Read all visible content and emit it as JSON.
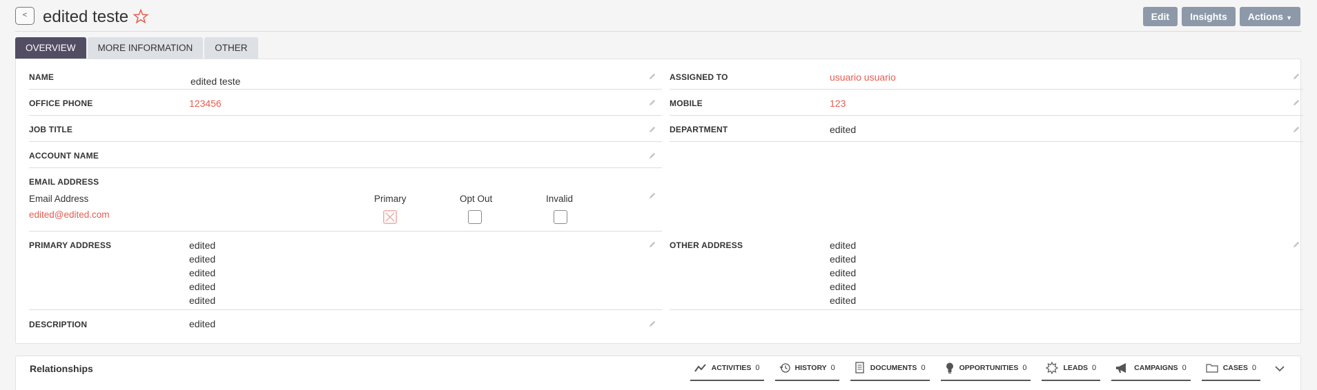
{
  "header": {
    "back_label": "<",
    "title": "edited teste",
    "buttons": {
      "edit": "Edit",
      "insights": "Insights",
      "actions": "Actions"
    }
  },
  "tabs": [
    {
      "label": "OVERVIEW"
    },
    {
      "label": "MORE INFORMATION"
    },
    {
      "label": "OTHER"
    }
  ],
  "fields": {
    "name": {
      "label": "NAME",
      "value": "edited teste"
    },
    "office_phone": {
      "label": "OFFICE PHONE",
      "value": "123456"
    },
    "job_title": {
      "label": "JOB TITLE",
      "value": ""
    },
    "account_name": {
      "label": "ACCOUNT NAME",
      "value": ""
    },
    "email": {
      "label": "EMAIL ADDRESS",
      "col_address": "Email Address",
      "col_primary": "Primary",
      "col_optout": "Opt Out",
      "col_invalid": "Invalid",
      "address": "edited@edited.com",
      "primary": true,
      "opt_out": false,
      "invalid": false
    },
    "primary_address": {
      "label": "PRIMARY ADDRESS",
      "lines": [
        "edited",
        "edited",
        "edited",
        "edited",
        "edited"
      ]
    },
    "description": {
      "label": "DESCRIPTION",
      "value": "edited"
    },
    "assigned_to": {
      "label": "ASSIGNED TO",
      "value": "usuario usuario"
    },
    "mobile": {
      "label": "MOBILE",
      "value": "123"
    },
    "department": {
      "label": "DEPARTMENT",
      "value": "edited"
    },
    "other_address": {
      "label": "OTHER ADDRESS",
      "lines": [
        "edited",
        "edited",
        "edited",
        "edited",
        "edited"
      ]
    }
  },
  "relationships": {
    "title": "Relationships",
    "tabs": [
      {
        "label": "ACTIVITIES",
        "count": "0",
        "icon": "activities-icon"
      },
      {
        "label": "HISTORY",
        "count": "0",
        "icon": "history-icon"
      },
      {
        "label": "DOCUMENTS",
        "count": "0",
        "icon": "documents-icon"
      },
      {
        "label": "OPPORTUNITIES",
        "count": "0",
        "icon": "opportunities-icon"
      },
      {
        "label": "LEADS",
        "count": "0",
        "icon": "leads-icon"
      },
      {
        "label": "CAMPAIGNS",
        "count": "0",
        "icon": "campaigns-icon"
      },
      {
        "label": "CASES",
        "count": "0",
        "icon": "cases-icon"
      }
    ]
  },
  "colors": {
    "accent": "#534d64",
    "link": "#e65c4f",
    "button": "#8d99a8"
  }
}
